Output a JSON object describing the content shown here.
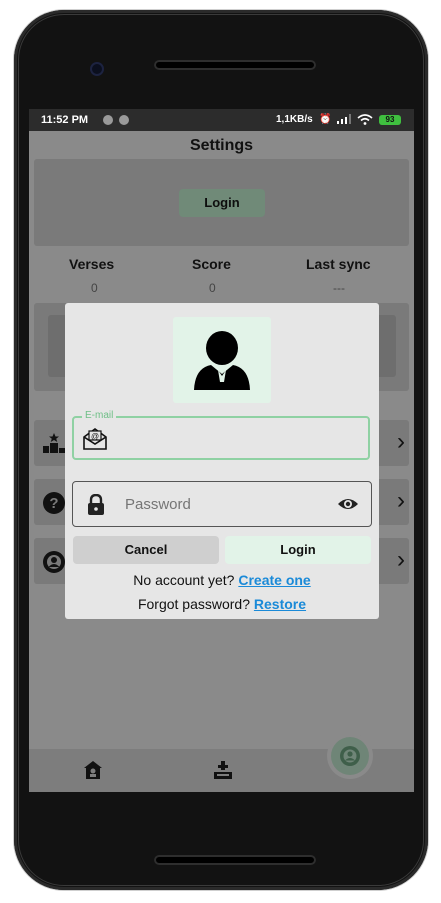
{
  "status": {
    "time": "11:52 PM",
    "network": "1,1KB/s",
    "battery": "93"
  },
  "header": {
    "title": "Settings"
  },
  "account": {
    "login_label": "Login"
  },
  "stats": {
    "headers": [
      "Verses",
      "Score",
      "Last sync"
    ],
    "values": [
      "0",
      "0",
      "---"
    ]
  },
  "dialog": {
    "email_label": "E-mail",
    "email_value": "",
    "password_placeholder": "Password",
    "cancel_label": "Cancel",
    "login_label": "Login",
    "no_account_text": "No account yet?",
    "create_link": "Create one",
    "forgot_text": "Forgot password?",
    "restore_link": "Restore"
  },
  "colors": {
    "accent_green": "#8fd1a3",
    "link_blue": "#1a8ad8",
    "dialog_bg": "#e6e6e6"
  },
  "icons": [
    "leaderboard-icon",
    "help-icon",
    "settings-user-icon",
    "chevron-right-icon",
    "home-icon",
    "upload-icon",
    "account-fab-icon",
    "user-avatar-icon",
    "email-icon",
    "lock-icon",
    "eye-icon"
  ]
}
